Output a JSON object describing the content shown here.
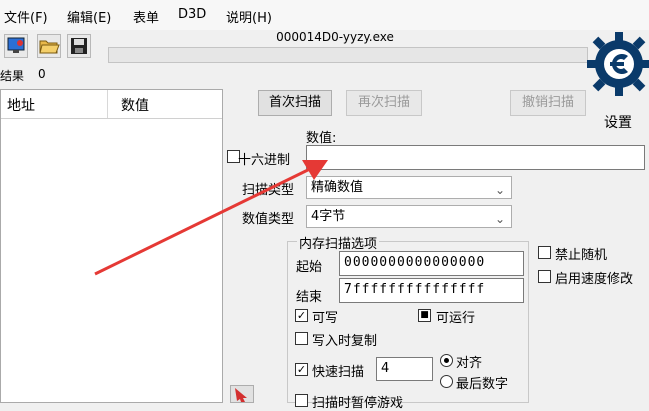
{
  "menu": [
    "文件(F)",
    "编辑(E)",
    "表单",
    "D3D",
    "说明(H)"
  ],
  "toolbar": {
    "icons": [
      "monitor-icon",
      "open-folder-icon",
      "save-disk-icon"
    ]
  },
  "process": {
    "title": "000014D0-yyzy.exe"
  },
  "results": {
    "label": "结果",
    "count": "0"
  },
  "list": {
    "col_address": "地址",
    "col_value": "数值"
  },
  "buttons": {
    "first_scan": "首次扫描",
    "next_scan": "再次扫描",
    "undo_scan": "撤销扫描"
  },
  "logo": {
    "settings_label": "设置",
    "brand_text": "Cheat Engine",
    "brand_color": "#0a3a6a"
  },
  "form": {
    "value_label": "数值:",
    "value_input": "",
    "hex_label": "十六进制",
    "scan_type_label": "扫描类型",
    "scan_type_value": "精确数值",
    "value_type_label": "数值类型",
    "value_type_value": "4字节"
  },
  "memory_options": {
    "title": "内存扫描选项",
    "start_label": "起始",
    "start_value": "0000000000000000",
    "end_label": "结束",
    "end_value": "7fffffffffffffff",
    "writable_label": "可写",
    "executable_label": "可运行",
    "copy_on_write_label": "写入时复制",
    "fast_scan_label": "快速扫描",
    "fast_scan_value": "4",
    "align_label": "对齐",
    "last_digits_label": "最后数字",
    "pause_label": "扫描时暂停游戏"
  },
  "right_options": {
    "disable_random": "禁止随机",
    "speedhack": "启用速度修改"
  },
  "annotation": {
    "arrow_color": "#e53935"
  }
}
